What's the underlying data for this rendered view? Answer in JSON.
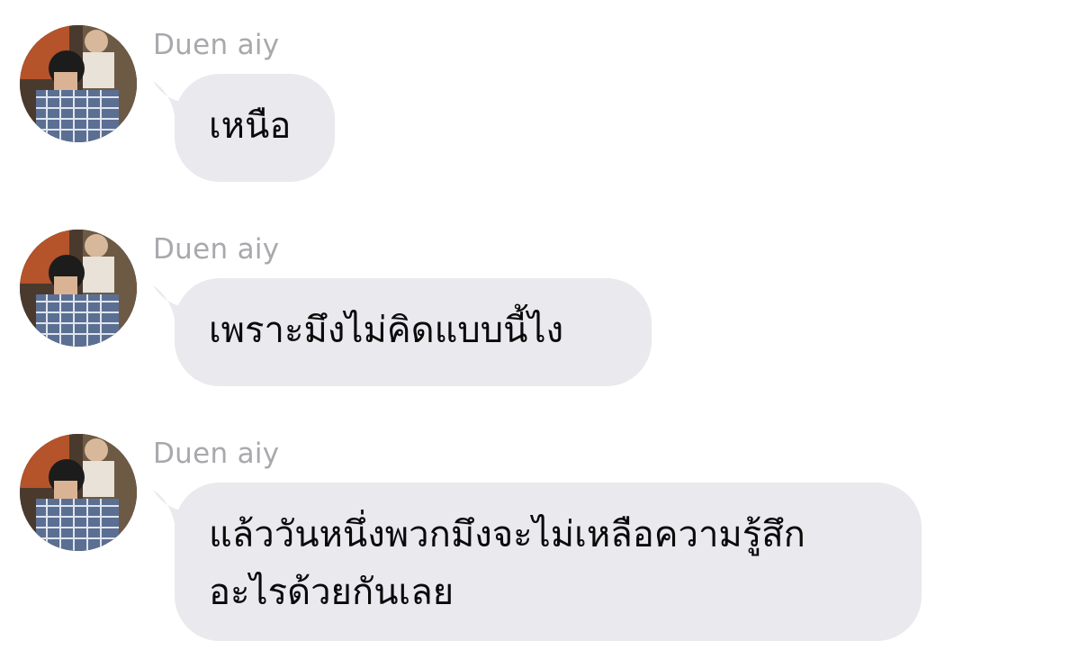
{
  "conversation": {
    "messages": [
      {
        "sender": "Duen aiy",
        "avatar": "profile-photo",
        "lines": [
          "เหนือ"
        ]
      },
      {
        "sender": "Duen aiy",
        "avatar": "profile-photo",
        "lines": [
          "เพราะมึงไม่คิดแบบนี้ไง"
        ]
      },
      {
        "sender": "Duen aiy",
        "avatar": "profile-photo",
        "lines": [
          "แล้ววันหนึ่งพวกมึงจะไม่เหลือความรู้สึก",
          "อะไรด้วยกันเลย"
        ]
      }
    ]
  },
  "colors": {
    "bubble_background": "#e9e9ee",
    "sender_name": "#a9a9ad",
    "message_text": "#0a0a0a",
    "background": "#ffffff"
  }
}
